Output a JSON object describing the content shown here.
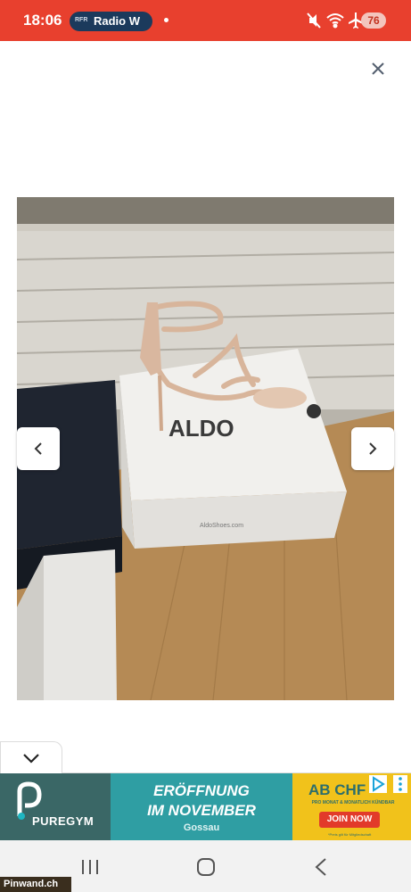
{
  "status_bar": {
    "time": "18:06",
    "radio_logo": "RFR",
    "radio_label": "Radio W",
    "battery": "76",
    "icons": [
      "mute-icon",
      "wifi-icon",
      "airplane-icon"
    ],
    "color": "#e8402e"
  },
  "viewer": {
    "close_icon": "close-icon",
    "prev_icon": "chevron-left-icon",
    "next_icon": "chevron-right-icon",
    "photo": {
      "box_brand": "ALDO",
      "box_url": "AldoShoes.com"
    }
  },
  "collapse": {
    "icon": "chevron-down-icon"
  },
  "ad": {
    "brand": "PUREGYM",
    "headline_line1": "ERÖFFNUNG",
    "headline_line2": "IM NOVEMBER",
    "location": "Gossau",
    "price": "AB CHF",
    "small_print": "PRO MONAT & MONATLICH KÜNDBAR",
    "cta": "JOIN NOW",
    "fine_print": "*Preis gilt für Mitgliedschaft",
    "colors": {
      "brand_bg": "#3a6766",
      "mid_bg": "#2f9ea3",
      "right_bg": "#f1c21b",
      "cta_bg": "#e23a2a"
    }
  },
  "bottom_nav": {
    "icons": [
      "recents-icon",
      "home-icon",
      "back-icon"
    ]
  },
  "watermark": "Pinwand.ch"
}
